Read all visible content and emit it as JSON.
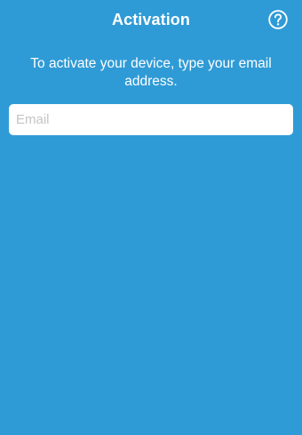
{
  "header": {
    "title": "Activation",
    "help_icon": "question-circle-icon"
  },
  "main": {
    "instruction": "To activate your device, type your email address.",
    "email": {
      "placeholder": "Email",
      "value": ""
    }
  },
  "colors": {
    "background": "#2f9bd6",
    "text": "#ffffff",
    "field_background": "#ffffff",
    "placeholder": "#c4c4c4"
  }
}
